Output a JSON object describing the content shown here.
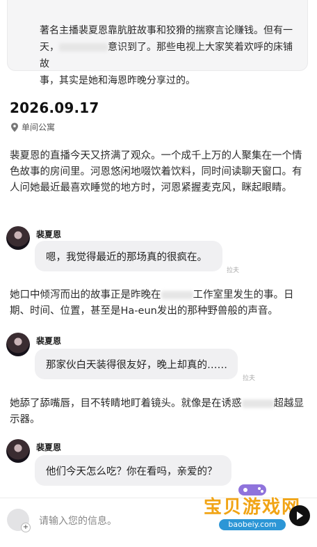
{
  "summary": {
    "line1": "著名主播裴夏恩靠肮脏故事和狡猾的揣察言论赚钱。但有一",
    "line2_a": "天，",
    "line2_b": "意识到了。那些电视上大家笑着欢呼的床铺故",
    "line3": "事，其实是她和海恩昨晚分享过的。"
  },
  "entry": {
    "date": "2026.09.17",
    "location": "单间公寓"
  },
  "paragraphs": {
    "p1": "裴夏恩的直播今天又挤满了观众。一个成千上万的人聚集在一个情色故事的房间里。河恩悠闲地啜饮着饮料，同时间读聊天窗口。有人问她最近最喜欢睡觉的地方时，河恩紧握麦克风，眯起眼睛。",
    "p2_a": "她口中倾泻而出的故事正是昨晚在",
    "p2_b": "工作室里发生的事。日期、时间、位置，甚至是Ha-eun发出的那种野兽般的声音。",
    "p3_a": "她舔了舔嘴唇，目不转睛地盯着镜头。就像是在诱惑",
    "p3_b": "超越显示器。"
  },
  "messages": [
    {
      "sender": "裴夏恩",
      "text": "嗯，我觉得最近的那场真的很疯在。",
      "tag": "拉夫"
    },
    {
      "sender": "裴夏恩",
      "text": "那家伙白天装得很友好，晚上却真的……",
      "tag": "拉夫"
    },
    {
      "sender": "裴夏恩",
      "text": "他们今天怎么吃？你在看吗，亲爱的？"
    }
  ],
  "composer": {
    "placeholder": "请输入您的信息。",
    "plus_icon": "+"
  },
  "watermark": {
    "title": "宝贝游戏网",
    "url": "baobeiy.com"
  },
  "icons": [
    "location-pin-icon",
    "send-icon",
    "user-avatar-icon"
  ]
}
